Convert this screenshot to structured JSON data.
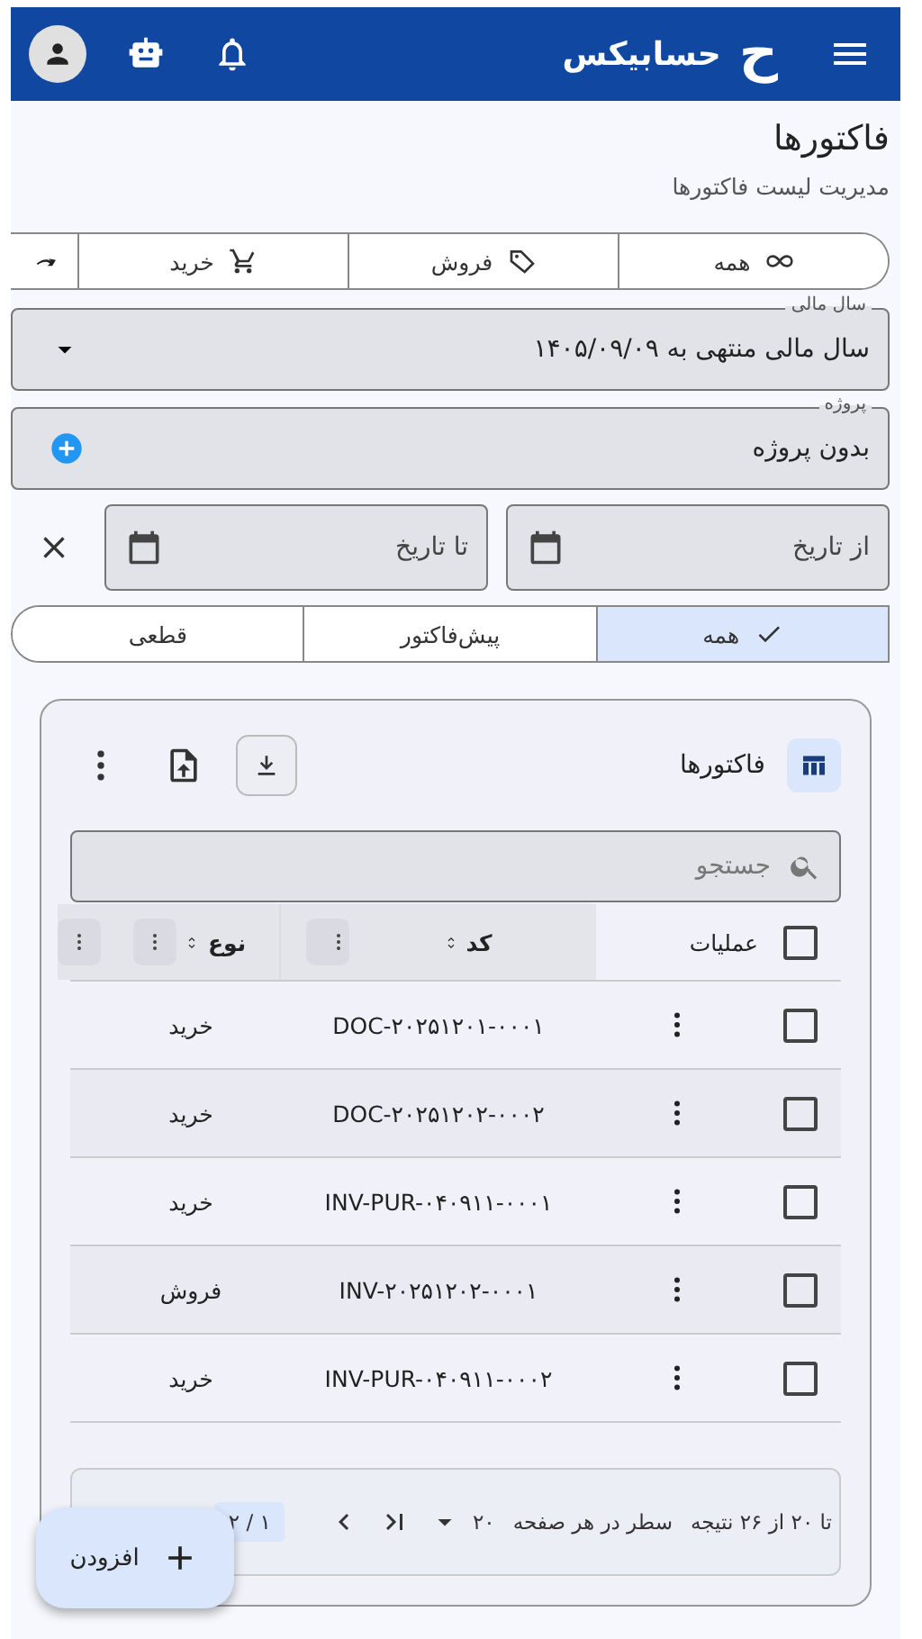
{
  "app_bar": {
    "logo": "ح",
    "title": "حسابیکس"
  },
  "page": {
    "title": "فاکتورها",
    "subtitle": "مدیریت لیست فاکتورها"
  },
  "type_filter": [
    {
      "label": "همه",
      "selected": false
    },
    {
      "label": "فروش",
      "selected": false
    },
    {
      "label": "خرید",
      "selected": false
    }
  ],
  "fiscal_year": {
    "label": "سال مالی",
    "value": "سال مالی منتهی به ۱۴۰۵/۰۹/۰۹"
  },
  "project": {
    "label": "پروژه",
    "value": "بدون پروژه"
  },
  "date_range": {
    "from_placeholder": "از تاریخ",
    "to_placeholder": "تا تاریخ"
  },
  "status_filter": [
    {
      "label": "همه",
      "selected": true
    },
    {
      "label": "پیش‌فاکتور",
      "selected": false
    },
    {
      "label": "قطعی",
      "selected": false
    }
  ],
  "table": {
    "title": "فاکتورها",
    "search_placeholder": "جستجو",
    "select_all_checked": false,
    "columns": [
      {
        "label": "عملیات",
        "sortable": false
      },
      {
        "label": "کد",
        "sortable": true
      },
      {
        "label": "نوع",
        "sortable": true
      }
    ],
    "rows": [
      {
        "checked": false,
        "code": "DOC-۲۰۲۵۱۲۰۱-۰۰۰۱",
        "type": "خرید"
      },
      {
        "checked": false,
        "code": "DOC-۲۰۲۵۱۲۰۲-۰۰۰۲",
        "type": "خرید"
      },
      {
        "checked": false,
        "code": "INV-PUR-۰۴۰۹۱۱-۰۰۰۱",
        "type": "خرید"
      },
      {
        "checked": false,
        "code": "INV-۲۰۲۵۱۲۰۲-۰۰۰۱",
        "type": "فروش"
      },
      {
        "checked": false,
        "code": "INV-PUR-۰۴۰۹۱۱-۰۰۰۲",
        "type": "خرید"
      }
    ],
    "pagination": {
      "range": "تا ۲۰ از ۲۶ نتیجه",
      "rows_per_page_label": "سطر در هر صفحه",
      "rows_per_page": "۲۰",
      "page": "۱ / ۲"
    }
  },
  "fab": {
    "label": "افزودن"
  }
}
